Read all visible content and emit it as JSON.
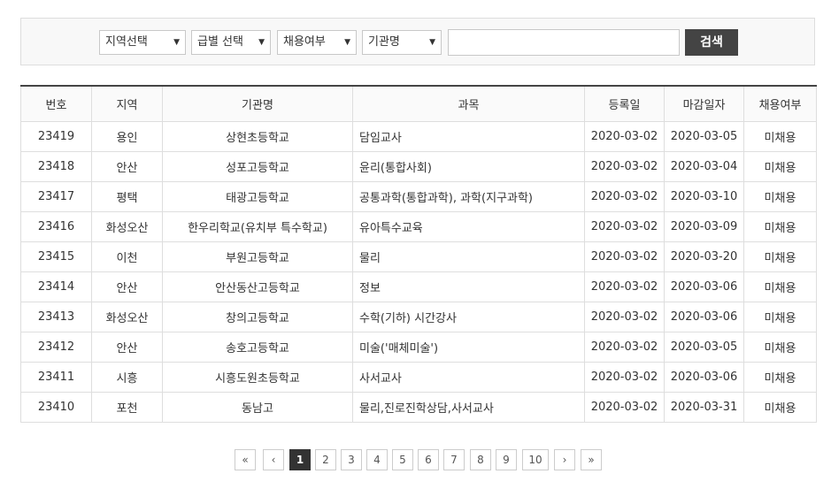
{
  "search": {
    "region_label": "지역선택",
    "grade_label": "급별 선택",
    "hire_label": "채용여부",
    "org_label": "기관명",
    "arrow": "▼",
    "keyword_value": "",
    "button_label": "검색"
  },
  "table": {
    "headers": [
      "번호",
      "지역",
      "기관명",
      "과목",
      "등록일",
      "마감일자",
      "채용여부"
    ],
    "rows": [
      [
        "23419",
        "용인",
        "상현초등학교",
        "담임교사",
        "2020-03-02",
        "2020-03-05",
        "미채용"
      ],
      [
        "23418",
        "안산",
        "성포고등학교",
        "윤리(통합사회)",
        "2020-03-02",
        "2020-03-04",
        "미채용"
      ],
      [
        "23417",
        "평택",
        "태광고등학교",
        "공통과학(통합과학), 과학(지구과학)",
        "2020-03-02",
        "2020-03-10",
        "미채용"
      ],
      [
        "23416",
        "화성오산",
        "한우리학교(유치부 특수학교)",
        "유아특수교육",
        "2020-03-02",
        "2020-03-09",
        "미채용"
      ],
      [
        "23415",
        "이천",
        "부원고등학교",
        "물리",
        "2020-03-02",
        "2020-03-20",
        "미채용"
      ],
      [
        "23414",
        "안산",
        "안산동산고등학교",
        "정보",
        "2020-03-02",
        "2020-03-06",
        "미채용"
      ],
      [
        "23413",
        "화성오산",
        "창의고등학교",
        "수학(기하) 시간강사",
        "2020-03-02",
        "2020-03-06",
        "미채용"
      ],
      [
        "23412",
        "안산",
        "송호고등학교",
        "미술('매체미술')",
        "2020-03-02",
        "2020-03-05",
        "미채용"
      ],
      [
        "23411",
        "시흥",
        "시흥도원초등학교",
        "사서교사",
        "2020-03-02",
        "2020-03-06",
        "미채용"
      ],
      [
        "23410",
        "포천",
        "동남고",
        "물리,진로진학상담,사서교사",
        "2020-03-02",
        "2020-03-31",
        "미채용"
      ]
    ]
  },
  "pagination": {
    "first": "«",
    "prev": "‹",
    "pages": [
      "1",
      "2",
      "3",
      "4",
      "5",
      "6",
      "7",
      "8",
      "9",
      "10"
    ],
    "current": "1",
    "next": "›",
    "last": "»"
  }
}
